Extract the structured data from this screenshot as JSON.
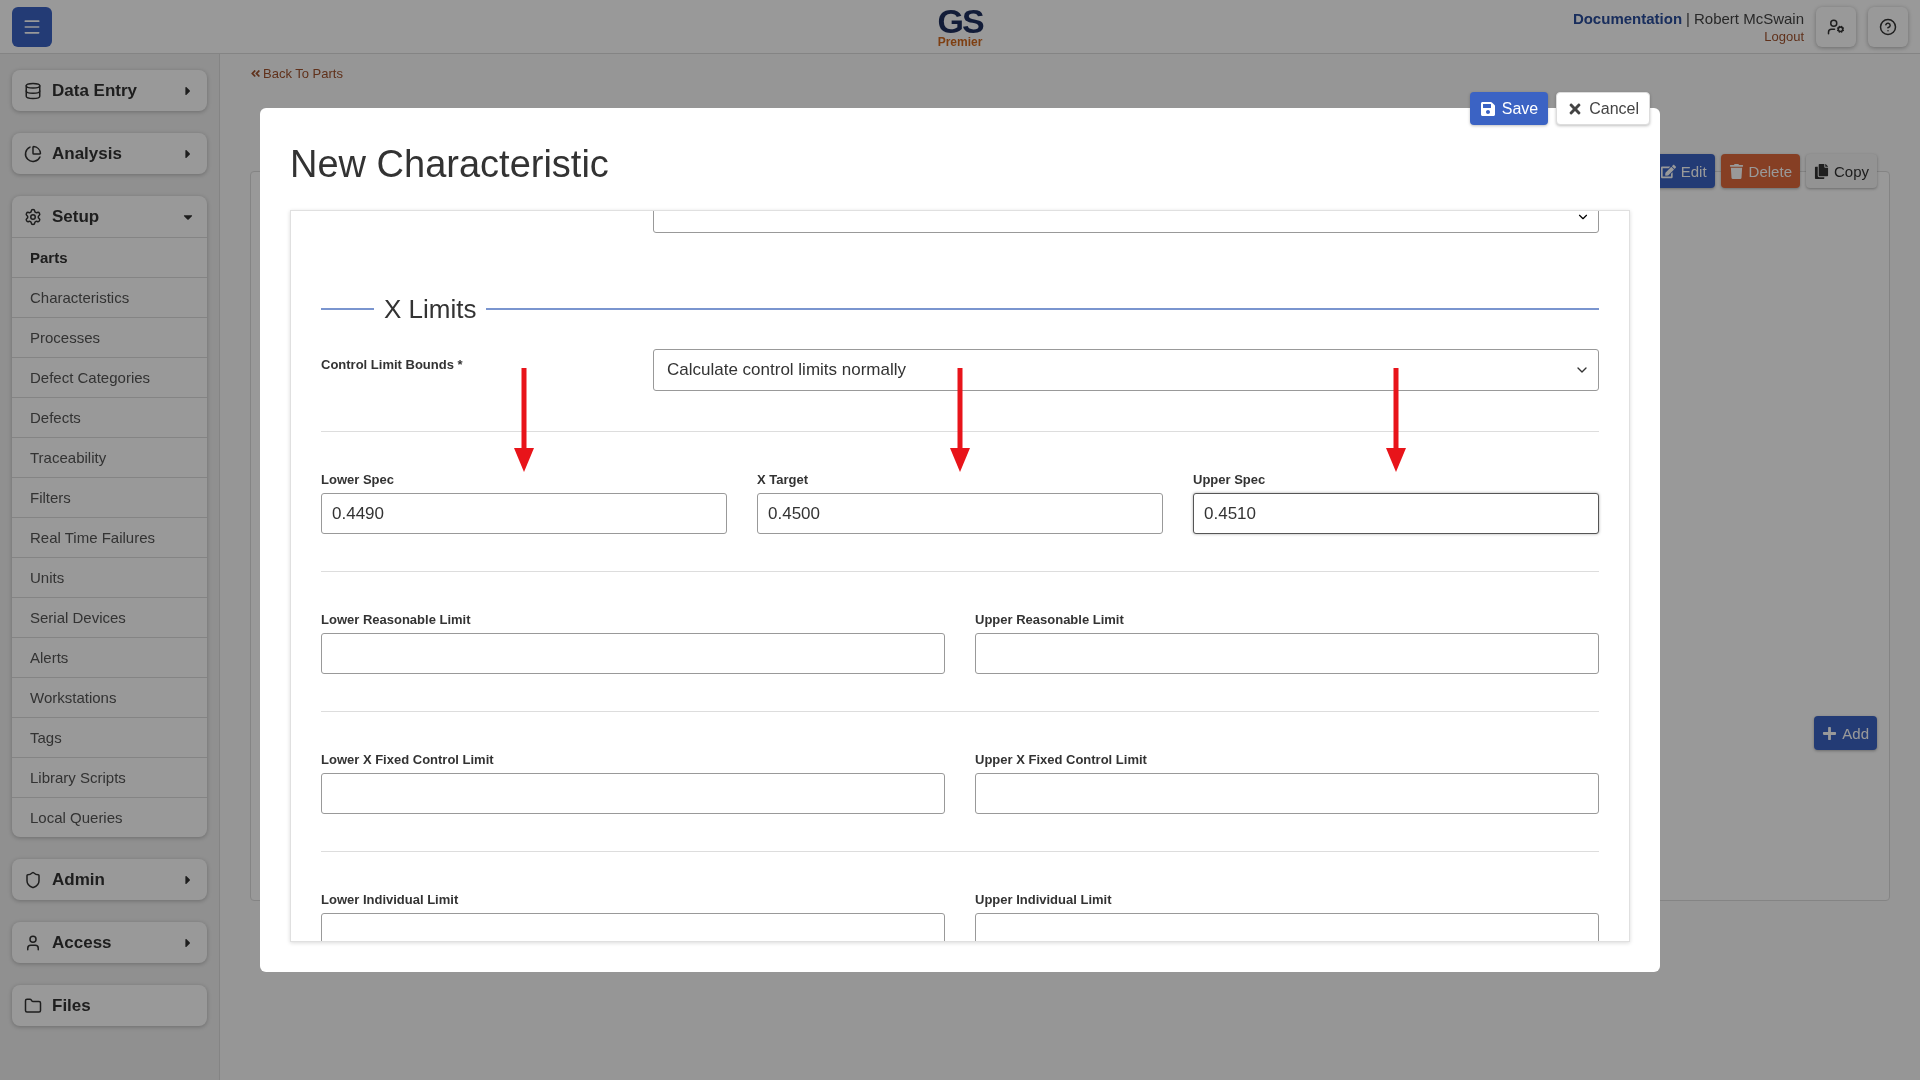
{
  "header": {
    "logo": {
      "mark": "GS",
      "sub": "Premier"
    },
    "doc_link": "Documentation",
    "separator": "|",
    "user": "Robert McSwain",
    "logout": "Logout"
  },
  "sidebar": [
    {
      "label": "Data Entry",
      "expanded": false
    },
    {
      "label": "Analysis",
      "expanded": false
    },
    {
      "label": "Setup",
      "expanded": true,
      "items": [
        {
          "label": "Parts",
          "selected": true
        },
        {
          "label": "Characteristics",
          "selected": false
        },
        {
          "label": "Processes",
          "selected": false
        },
        {
          "label": "Defect Categories",
          "selected": false
        },
        {
          "label": "Defects",
          "selected": false
        },
        {
          "label": "Traceability",
          "selected": false
        },
        {
          "label": "Filters",
          "selected": false
        },
        {
          "label": "Real Time Failures",
          "selected": false
        },
        {
          "label": "Units",
          "selected": false
        },
        {
          "label": "Serial Devices",
          "selected": false
        },
        {
          "label": "Alerts",
          "selected": false
        },
        {
          "label": "Workstations",
          "selected": false
        },
        {
          "label": "Tags",
          "selected": false
        },
        {
          "label": "Library Scripts",
          "selected": false
        },
        {
          "label": "Local Queries",
          "selected": false
        }
      ]
    },
    {
      "label": "Admin",
      "expanded": false
    },
    {
      "label": "Access",
      "expanded": false
    },
    {
      "label": "Files"
    }
  ],
  "background_page": {
    "back_link": "Back To Parts",
    "buttons": [
      {
        "label": "Edit",
        "kind": "edit"
      },
      {
        "label": "Delete",
        "kind": "delete"
      },
      {
        "label": "Copy",
        "kind": "copy"
      }
    ],
    "add_button": "Add"
  },
  "modal": {
    "title": "New Characteristic",
    "actions": [
      {
        "label": "Save",
        "kind": "save"
      },
      {
        "label": "Cancel",
        "kind": "cancel"
      }
    ],
    "clipped_field": {
      "kind": "select"
    },
    "section_title": "X Limits",
    "bounds": {
      "label": "Control Limit Bounds *",
      "value": "Calculate control limits normally"
    },
    "rows": [
      [
        {
          "label": "Lower Spec",
          "value": "0.4490",
          "focused": false,
          "arrow": true
        },
        {
          "label": "X Target",
          "value": "0.4500",
          "focused": false,
          "arrow": true
        },
        {
          "label": "Upper Spec",
          "value": "0.4510",
          "focused": true,
          "arrow": true
        }
      ],
      [
        {
          "label": "Lower Reasonable Limit",
          "focused": false
        },
        {
          "label": "Upper Reasonable Limit",
          "focused": false
        }
      ],
      [
        {
          "label": "Lower X Fixed Control Limit",
          "focused": false
        },
        {
          "label": "Upper X Fixed Control Limit",
          "focused": false
        }
      ],
      [
        {
          "label": "Lower Individual Limit",
          "focused": false
        },
        {
          "label": "Upper Individual Limit",
          "focused": false
        }
      ]
    ]
  }
}
